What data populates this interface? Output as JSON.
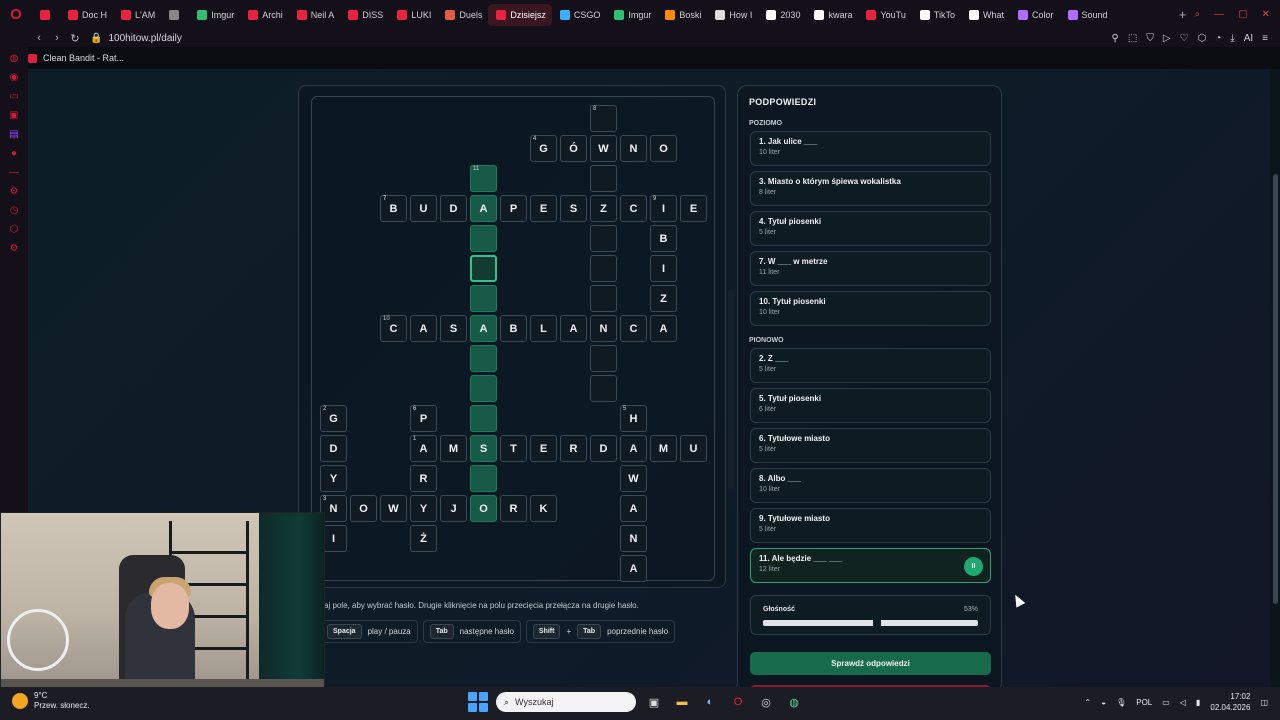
{
  "browser": {
    "tabs": [
      {
        "label": "",
        "color": "#e8223f"
      },
      {
        "label": "Doc H",
        "color": "#e8223f"
      },
      {
        "label": "L'AM",
        "color": "#e8223f"
      },
      {
        "label": "",
        "color": "#888888"
      },
      {
        "label": "Imgur",
        "color": "#2fbf71"
      },
      {
        "label": "Archi",
        "color": "#e8223f"
      },
      {
        "label": "Neil A",
        "color": "#e8223f"
      },
      {
        "label": "DISS",
        "color": "#e8223f"
      },
      {
        "label": "LUKI",
        "color": "#e8223f"
      },
      {
        "label": "Duels",
        "color": "#e25b45"
      },
      {
        "label": "Dzisiejsz",
        "color": "#e8223f",
        "active": true
      },
      {
        "label": "CSGO",
        "color": "#3ab0ff"
      },
      {
        "label": "Imgur",
        "color": "#2fbf71"
      },
      {
        "label": "Boski",
        "color": "#ff8a00"
      },
      {
        "label": "How I",
        "color": "#dddddd"
      },
      {
        "label": "2030",
        "color": "#ffffff"
      },
      {
        "label": "kwara",
        "color": "#ffffff"
      },
      {
        "label": "YouTu",
        "color": "#e8223f"
      },
      {
        "label": "TikTo",
        "color": "#ffffff"
      },
      {
        "label": "What",
        "color": "#ffffff"
      },
      {
        "label": "Color",
        "color": "#b06cff"
      },
      {
        "label": "Sound",
        "color": "#b06cff"
      }
    ],
    "add_tab": "+",
    "url": "100hitow.pl/daily",
    "ai_label": "AI",
    "bookmark": "Clean Bandit - Rat..."
  },
  "panel": {
    "title": "PODPOWIEDZI",
    "across_label": "POZIOMO",
    "down_label": "PIONOWO",
    "across": [
      {
        "title": "1. Jak ulice ___",
        "sub": "10 liter"
      },
      {
        "title": "3. Miasto o którym śpiewa wokalistka",
        "sub": "8 liter"
      },
      {
        "title": "4. Tytuł piosenki",
        "sub": "5 liter"
      },
      {
        "title": "7. W ___ w metrze",
        "sub": "11 liter"
      },
      {
        "title": "10. Tytuł piosenki",
        "sub": "10 liter"
      }
    ],
    "down": [
      {
        "title": "2. Z ___",
        "sub": "5 liter"
      },
      {
        "title": "5. Tytuł piosenki",
        "sub": "6 liter"
      },
      {
        "title": "6. Tytułowe miasto",
        "sub": "5 liter"
      },
      {
        "title": "8. Albo ___",
        "sub": "10 liter"
      },
      {
        "title": "9. Tytułowe miasto",
        "sub": "5 liter"
      },
      {
        "title": "11. Ale będzie ___ ___",
        "sub": "12 liter",
        "active": true
      }
    ],
    "pause_symbol": "II",
    "volume_label": "Głośność",
    "volume_value": "53%",
    "volume_fraction": 0.53,
    "check_label": "Sprawdź odpowiedzi"
  },
  "hint": "aj pole, aby wybrać hasło. Drugie kliknięcie na polu przecięcia przełącza na drugie hasło.",
  "keys": {
    "space": "Spacja",
    "space_desc": "play / pauza",
    "tab": "Tab",
    "tab_desc": "następne hasło",
    "shift": "Shift",
    "plus": "+",
    "tab2": "Tab",
    "shift_desc": "poprzednie hasło"
  },
  "grid": [
    {
      "c": 9,
      "r": 0,
      "n": "8"
    },
    {
      "c": 7,
      "r": 1,
      "l": "G",
      "n": "4"
    },
    {
      "c": 8,
      "r": 1,
      "l": "Ó"
    },
    {
      "c": 9,
      "r": 1,
      "l": "W"
    },
    {
      "c": 10,
      "r": 1,
      "l": "N"
    },
    {
      "c": 11,
      "r": 1,
      "l": "O"
    },
    {
      "c": 5,
      "r": 2,
      "n": "11",
      "hl": true
    },
    {
      "c": 9,
      "r": 2
    },
    {
      "c": 2,
      "r": 3,
      "l": "B",
      "n": "7"
    },
    {
      "c": 3,
      "r": 3,
      "l": "U"
    },
    {
      "c": 4,
      "r": 3,
      "l": "D"
    },
    {
      "c": 5,
      "r": 3,
      "l": "A",
      "hl": true
    },
    {
      "c": 6,
      "r": 3,
      "l": "P"
    },
    {
      "c": 7,
      "r": 3,
      "l": "E"
    },
    {
      "c": 8,
      "r": 3,
      "l": "S"
    },
    {
      "c": 9,
      "r": 3,
      "l": "Z"
    },
    {
      "c": 10,
      "r": 3,
      "l": "C"
    },
    {
      "c": 11,
      "r": 3,
      "l": "I",
      "n": "9"
    },
    {
      "c": 12,
      "r": 3,
      "l": "E"
    },
    {
      "c": 5,
      "r": 4,
      "hl": true
    },
    {
      "c": 9,
      "r": 4
    },
    {
      "c": 11,
      "r": 4,
      "l": "B"
    },
    {
      "c": 5,
      "r": 5,
      "cur": true
    },
    {
      "c": 9,
      "r": 5
    },
    {
      "c": 11,
      "r": 5,
      "l": "I"
    },
    {
      "c": 5,
      "r": 6,
      "hl": true
    },
    {
      "c": 9,
      "r": 6
    },
    {
      "c": 11,
      "r": 6,
      "l": "Z"
    },
    {
      "c": 2,
      "r": 7,
      "l": "C",
      "n": "10"
    },
    {
      "c": 3,
      "r": 7,
      "l": "A"
    },
    {
      "c": 4,
      "r": 7,
      "l": "S"
    },
    {
      "c": 5,
      "r": 7,
      "l": "A",
      "hl": true
    },
    {
      "c": 6,
      "r": 7,
      "l": "B"
    },
    {
      "c": 7,
      "r": 7,
      "l": "L"
    },
    {
      "c": 8,
      "r": 7,
      "l": "A"
    },
    {
      "c": 9,
      "r": 7,
      "l": "N"
    },
    {
      "c": 10,
      "r": 7,
      "l": "C"
    },
    {
      "c": 11,
      "r": 7,
      "l": "A"
    },
    {
      "c": 5,
      "r": 8,
      "hl": true
    },
    {
      "c": 9,
      "r": 8
    },
    {
      "c": 5,
      "r": 9,
      "hl": true
    },
    {
      "c": 9,
      "r": 9
    },
    {
      "c": 0,
      "r": 10,
      "l": "G",
      "n": "2"
    },
    {
      "c": 3,
      "r": 10,
      "l": "P",
      "n": "6"
    },
    {
      "c": 5,
      "r": 10,
      "hl": true
    },
    {
      "c": 10,
      "r": 10,
      "l": "H",
      "n": "5"
    },
    {
      "c": 0,
      "r": 11,
      "l": "D"
    },
    {
      "c": 3,
      "r": 11,
      "l": "A",
      "n": "1"
    },
    {
      "c": 4,
      "r": 11,
      "l": "M"
    },
    {
      "c": 5,
      "r": 11,
      "l": "S",
      "hl": true
    },
    {
      "c": 6,
      "r": 11,
      "l": "T"
    },
    {
      "c": 7,
      "r": 11,
      "l": "E"
    },
    {
      "c": 8,
      "r": 11,
      "l": "R"
    },
    {
      "c": 9,
      "r": 11,
      "l": "D"
    },
    {
      "c": 10,
      "r": 11,
      "l": "A"
    },
    {
      "c": 11,
      "r": 11,
      "l": "M"
    },
    {
      "c": 12,
      "r": 11,
      "l": "U"
    },
    {
      "c": 0,
      "r": 12,
      "l": "Y"
    },
    {
      "c": 3,
      "r": 12,
      "l": "R"
    },
    {
      "c": 5,
      "r": 12,
      "hl": true
    },
    {
      "c": 10,
      "r": 12,
      "l": "W"
    },
    {
      "c": 0,
      "r": 13,
      "l": "N",
      "n": "3"
    },
    {
      "c": 1,
      "r": 13,
      "l": "O"
    },
    {
      "c": 2,
      "r": 13,
      "l": "W"
    },
    {
      "c": 3,
      "r": 13,
      "l": "Y"
    },
    {
      "c": 4,
      "r": 13,
      "l": "J"
    },
    {
      "c": 5,
      "r": 13,
      "l": "O",
      "hl": true
    },
    {
      "c": 6,
      "r": 13,
      "l": "R"
    },
    {
      "c": 7,
      "r": 13,
      "l": "K"
    },
    {
      "c": 10,
      "r": 13,
      "l": "A"
    },
    {
      "c": 0,
      "r": 14,
      "l": "I"
    },
    {
      "c": 3,
      "r": 14,
      "l": "Ż"
    },
    {
      "c": 10,
      "r": 14,
      "l": "N"
    },
    {
      "c": 10,
      "r": 15,
      "l": "A"
    }
  ],
  "taskbar": {
    "temp": "9°C",
    "weather": "Przew. słonecz.",
    "search_placeholder": "Wyszukaj",
    "lang": "POL",
    "time": "17:02",
    "date": "02.04.2026"
  }
}
